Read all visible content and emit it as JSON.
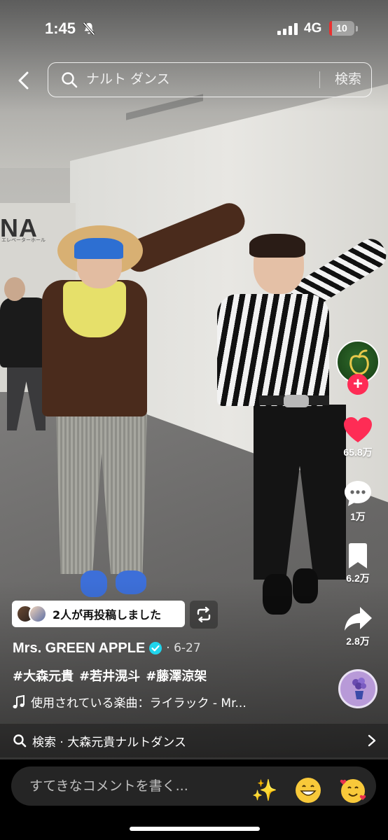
{
  "status_bar": {
    "time": "1:45",
    "network": "4G",
    "battery": "10",
    "battery_level": 0.1,
    "icons": [
      "bell-slash-icon",
      "signal-bars-icon"
    ]
  },
  "search": {
    "query": "ナルト ダンス",
    "submit_label": "検索",
    "icons": [
      "back-arrow-icon",
      "search-icon"
    ]
  },
  "scene": {
    "sign_text": "NA",
    "sign_subtext": "エレベーターホール"
  },
  "actions": {
    "like_count": "65.8万",
    "comment_count": "1万",
    "save_count": "6.2万",
    "share_count": "2.8万",
    "follow_symbol": "+",
    "icons": [
      "heart-icon",
      "comment-icon",
      "bookmark-icon",
      "share-arrow-icon",
      "music-disc-icon"
    ]
  },
  "caption": {
    "repost_text": "2人が再投稿しました",
    "author": "Mrs. GREEN APPLE",
    "date": "· 6-27",
    "hashtags": [
      "#大森元貴",
      "#若井滉斗",
      "#藤澤涼架"
    ],
    "music": "使用されている楽曲：ライラック - Mr..."
  },
  "search_suggestion": {
    "text": "検索 · 大森元貴ナルトダンス"
  },
  "comment_bar": {
    "placeholder": "すてきなコメントを書く...",
    "emojis": [
      "✨",
      "😁",
      "🥰"
    ]
  },
  "colors": {
    "like_red": "#fe2c55",
    "verified_blue": "#20d5ec",
    "battery_red": "#e9302f"
  }
}
